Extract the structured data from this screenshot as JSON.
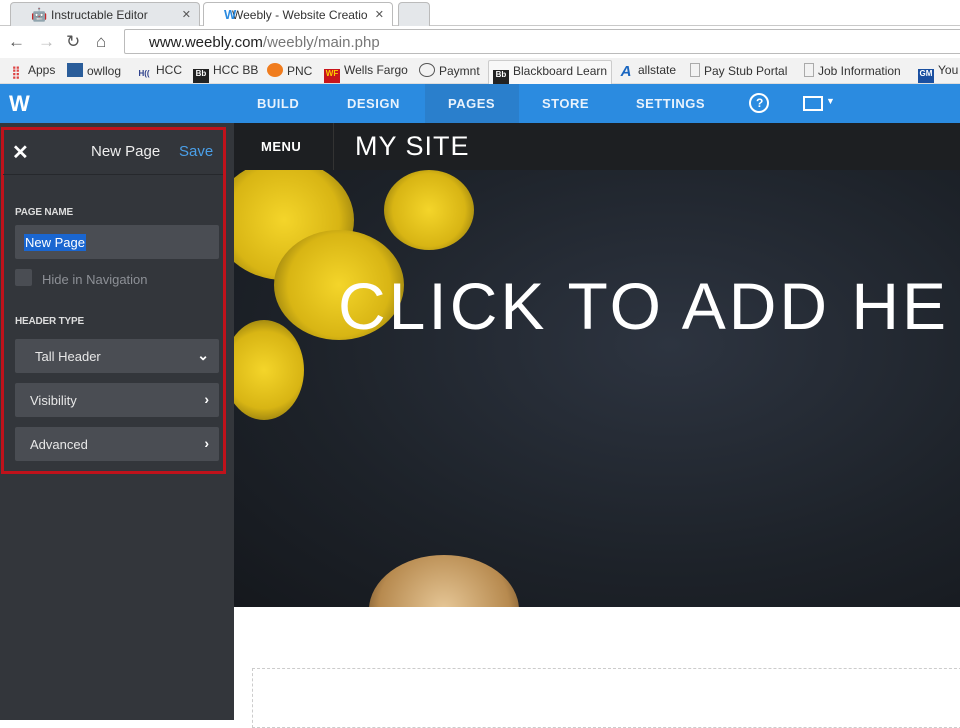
{
  "browser": {
    "tabs": [
      {
        "title": "Instructable Editor",
        "active": false
      },
      {
        "title": "Weebly - Website Creatio",
        "active": true
      }
    ],
    "url_host": "www.weebly.com",
    "url_path": "/weebly/main.php",
    "bookmarks": [
      "Apps",
      "owllog",
      "HCC",
      "HCC BB",
      "PNC",
      "Wells Fargo",
      "Paymnt",
      "Blackboard Learn",
      "allstate",
      "Pay Stub Portal",
      "Job Information",
      "You"
    ]
  },
  "weebly_nav": {
    "items": [
      "BUILD",
      "DESIGN",
      "PAGES",
      "STORE",
      "SETTINGS"
    ],
    "active": "PAGES",
    "help": "?"
  },
  "panel": {
    "title": "New Page",
    "save": "Save",
    "page_name_label": "PAGE NAME",
    "page_name_value": "New Page",
    "hide_nav_label": "Hide in Navigation",
    "header_type_label": "HEADER TYPE",
    "header_type_value": "Tall Header",
    "visibility": "Visibility",
    "advanced": "Advanced"
  },
  "site": {
    "menu": "MENU",
    "name": "MY SITE",
    "hero_text": "CLICK TO ADD HE"
  },
  "colors": {
    "accent": "#2b8be0",
    "highlight": "#c0121b"
  }
}
